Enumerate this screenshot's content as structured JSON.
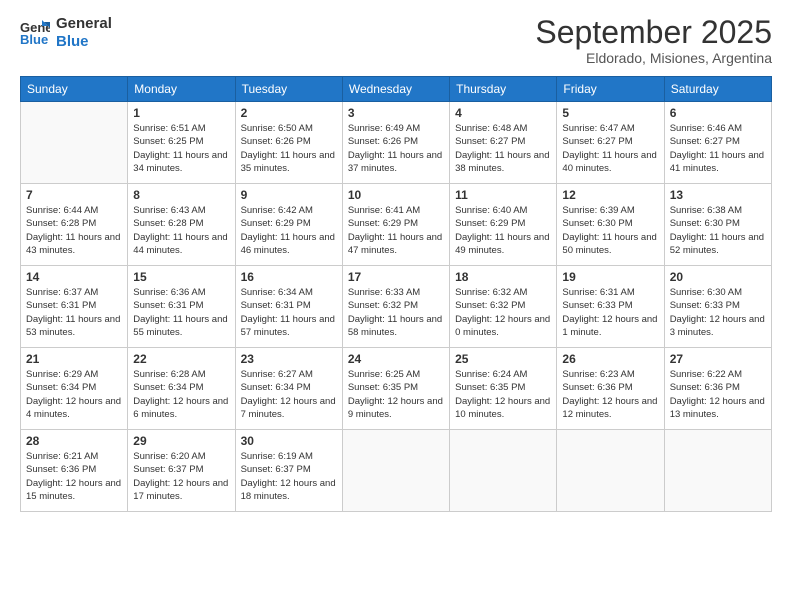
{
  "logo": {
    "line1": "General",
    "line2": "Blue"
  },
  "title": "September 2025",
  "subtitle": "Eldorado, Misiones, Argentina",
  "weekdays": [
    "Sunday",
    "Monday",
    "Tuesday",
    "Wednesday",
    "Thursday",
    "Friday",
    "Saturday"
  ],
  "weeks": [
    [
      {
        "day": "",
        "sunrise": "",
        "sunset": "",
        "daylight": ""
      },
      {
        "day": "1",
        "sunrise": "Sunrise: 6:51 AM",
        "sunset": "Sunset: 6:25 PM",
        "daylight": "Daylight: 11 hours and 34 minutes."
      },
      {
        "day": "2",
        "sunrise": "Sunrise: 6:50 AM",
        "sunset": "Sunset: 6:26 PM",
        "daylight": "Daylight: 11 hours and 35 minutes."
      },
      {
        "day": "3",
        "sunrise": "Sunrise: 6:49 AM",
        "sunset": "Sunset: 6:26 PM",
        "daylight": "Daylight: 11 hours and 37 minutes."
      },
      {
        "day": "4",
        "sunrise": "Sunrise: 6:48 AM",
        "sunset": "Sunset: 6:27 PM",
        "daylight": "Daylight: 11 hours and 38 minutes."
      },
      {
        "day": "5",
        "sunrise": "Sunrise: 6:47 AM",
        "sunset": "Sunset: 6:27 PM",
        "daylight": "Daylight: 11 hours and 40 minutes."
      },
      {
        "day": "6",
        "sunrise": "Sunrise: 6:46 AM",
        "sunset": "Sunset: 6:27 PM",
        "daylight": "Daylight: 11 hours and 41 minutes."
      }
    ],
    [
      {
        "day": "7",
        "sunrise": "Sunrise: 6:44 AM",
        "sunset": "Sunset: 6:28 PM",
        "daylight": "Daylight: 11 hours and 43 minutes."
      },
      {
        "day": "8",
        "sunrise": "Sunrise: 6:43 AM",
        "sunset": "Sunset: 6:28 PM",
        "daylight": "Daylight: 11 hours and 44 minutes."
      },
      {
        "day": "9",
        "sunrise": "Sunrise: 6:42 AM",
        "sunset": "Sunset: 6:29 PM",
        "daylight": "Daylight: 11 hours and 46 minutes."
      },
      {
        "day": "10",
        "sunrise": "Sunrise: 6:41 AM",
        "sunset": "Sunset: 6:29 PM",
        "daylight": "Daylight: 11 hours and 47 minutes."
      },
      {
        "day": "11",
        "sunrise": "Sunrise: 6:40 AM",
        "sunset": "Sunset: 6:29 PM",
        "daylight": "Daylight: 11 hours and 49 minutes."
      },
      {
        "day": "12",
        "sunrise": "Sunrise: 6:39 AM",
        "sunset": "Sunset: 6:30 PM",
        "daylight": "Daylight: 11 hours and 50 minutes."
      },
      {
        "day": "13",
        "sunrise": "Sunrise: 6:38 AM",
        "sunset": "Sunset: 6:30 PM",
        "daylight": "Daylight: 11 hours and 52 minutes."
      }
    ],
    [
      {
        "day": "14",
        "sunrise": "Sunrise: 6:37 AM",
        "sunset": "Sunset: 6:31 PM",
        "daylight": "Daylight: 11 hours and 53 minutes."
      },
      {
        "day": "15",
        "sunrise": "Sunrise: 6:36 AM",
        "sunset": "Sunset: 6:31 PM",
        "daylight": "Daylight: 11 hours and 55 minutes."
      },
      {
        "day": "16",
        "sunrise": "Sunrise: 6:34 AM",
        "sunset": "Sunset: 6:31 PM",
        "daylight": "Daylight: 11 hours and 57 minutes."
      },
      {
        "day": "17",
        "sunrise": "Sunrise: 6:33 AM",
        "sunset": "Sunset: 6:32 PM",
        "daylight": "Daylight: 11 hours and 58 minutes."
      },
      {
        "day": "18",
        "sunrise": "Sunrise: 6:32 AM",
        "sunset": "Sunset: 6:32 PM",
        "daylight": "Daylight: 12 hours and 0 minutes."
      },
      {
        "day": "19",
        "sunrise": "Sunrise: 6:31 AM",
        "sunset": "Sunset: 6:33 PM",
        "daylight": "Daylight: 12 hours and 1 minute."
      },
      {
        "day": "20",
        "sunrise": "Sunrise: 6:30 AM",
        "sunset": "Sunset: 6:33 PM",
        "daylight": "Daylight: 12 hours and 3 minutes."
      }
    ],
    [
      {
        "day": "21",
        "sunrise": "Sunrise: 6:29 AM",
        "sunset": "Sunset: 6:34 PM",
        "daylight": "Daylight: 12 hours and 4 minutes."
      },
      {
        "day": "22",
        "sunrise": "Sunrise: 6:28 AM",
        "sunset": "Sunset: 6:34 PM",
        "daylight": "Daylight: 12 hours and 6 minutes."
      },
      {
        "day": "23",
        "sunrise": "Sunrise: 6:27 AM",
        "sunset": "Sunset: 6:34 PM",
        "daylight": "Daylight: 12 hours and 7 minutes."
      },
      {
        "day": "24",
        "sunrise": "Sunrise: 6:25 AM",
        "sunset": "Sunset: 6:35 PM",
        "daylight": "Daylight: 12 hours and 9 minutes."
      },
      {
        "day": "25",
        "sunrise": "Sunrise: 6:24 AM",
        "sunset": "Sunset: 6:35 PM",
        "daylight": "Daylight: 12 hours and 10 minutes."
      },
      {
        "day": "26",
        "sunrise": "Sunrise: 6:23 AM",
        "sunset": "Sunset: 6:36 PM",
        "daylight": "Daylight: 12 hours and 12 minutes."
      },
      {
        "day": "27",
        "sunrise": "Sunrise: 6:22 AM",
        "sunset": "Sunset: 6:36 PM",
        "daylight": "Daylight: 12 hours and 13 minutes."
      }
    ],
    [
      {
        "day": "28",
        "sunrise": "Sunrise: 6:21 AM",
        "sunset": "Sunset: 6:36 PM",
        "daylight": "Daylight: 12 hours and 15 minutes."
      },
      {
        "day": "29",
        "sunrise": "Sunrise: 6:20 AM",
        "sunset": "Sunset: 6:37 PM",
        "daylight": "Daylight: 12 hours and 17 minutes."
      },
      {
        "day": "30",
        "sunrise": "Sunrise: 6:19 AM",
        "sunset": "Sunset: 6:37 PM",
        "daylight": "Daylight: 12 hours and 18 minutes."
      },
      {
        "day": "",
        "sunrise": "",
        "sunset": "",
        "daylight": ""
      },
      {
        "day": "",
        "sunrise": "",
        "sunset": "",
        "daylight": ""
      },
      {
        "day": "",
        "sunrise": "",
        "sunset": "",
        "daylight": ""
      },
      {
        "day": "",
        "sunrise": "",
        "sunset": "",
        "daylight": ""
      }
    ]
  ]
}
